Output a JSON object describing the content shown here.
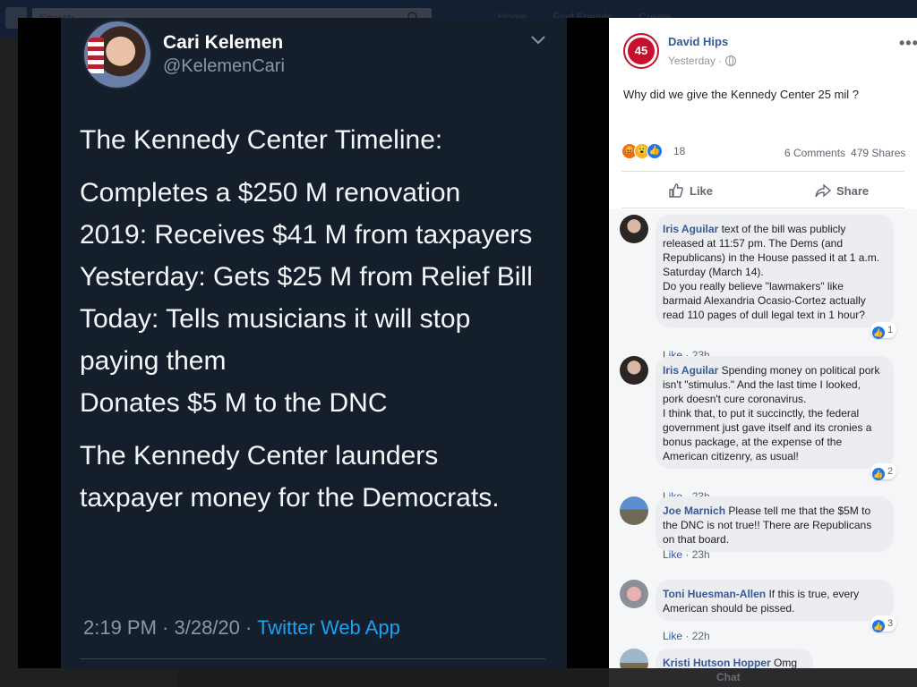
{
  "fb_background": {
    "search_placeholder": "Search",
    "nav": [
      "Home",
      "Find Friends",
      "Create"
    ],
    "chat_label": "Chat"
  },
  "tweet": {
    "name": "Cari Kelemen",
    "handle": "@KelemenCari",
    "paragraphs": [
      "The Kennedy Center Timeline:",
      "Completes a $250 M renovation\n2019: Receives $41 M from taxpayers\nYesterday: Gets $25 M from Relief Bill\nToday: Tells musicians it will stop paying them\nDonates $5 M to the DNC",
      "The Kennedy Center launders taxpayer money for the Democrats."
    ],
    "time": "2:19 PM · 3/28/20 · ",
    "source": "Twitter Web App"
  },
  "post": {
    "author": "David Hips",
    "avatar_text": "45",
    "time": "Yesterday ·",
    "text": "Why did we give the Kennedy Center 25 mil ?",
    "reaction_count": "18",
    "comments_count": "6 Comments",
    "shares_count": "479 Shares",
    "like_label": "Like",
    "share_label": "Share"
  },
  "comments": [
    {
      "author": "Iris Aguilar",
      "text": "text of the bill was publicly released at 11:57 pm. The Dems (and Republicans) in the House passed it at 1 a.m. Saturday (March 14).\nDo you really believe \"lawmakers\" like barmaid Alexandria Ocasio-Cortez actually read 110 pages of dull legal text in 1 hour?",
      "like": "Like",
      "time": "23h",
      "reactions": "1"
    },
    {
      "author": "Iris Aguilar",
      "text": "Spending money on political pork isn't \"stimulus.\" And the last time I looked, pork doesn't cure coronavirus.\nI think that, to put it succinctly, the federal government just gave itself and its cronies a bonus package, at the expense of the American citizenry, as usual!",
      "like": "Like",
      "time": "23h",
      "reactions": "2"
    },
    {
      "author": "Joe Marnich",
      "text": "Please tell me that the $5M to the DNC is not true!! There are Republicans on that board.",
      "like": "Like",
      "time": "23h",
      "reactions": ""
    },
    {
      "author": "Toni Huesman-Allen",
      "text": "If this is true, every American should be pissed.",
      "like": "Like",
      "time": "22h",
      "reactions": "3"
    },
    {
      "author": "Kristi Hutson Hopper",
      "text": "Omg",
      "like": "",
      "time": "",
      "reactions": ""
    }
  ],
  "colors": {
    "tweet_bg": "#151e2b",
    "link_blue": "#1da1f2",
    "fb_name_blue": "#385898"
  }
}
